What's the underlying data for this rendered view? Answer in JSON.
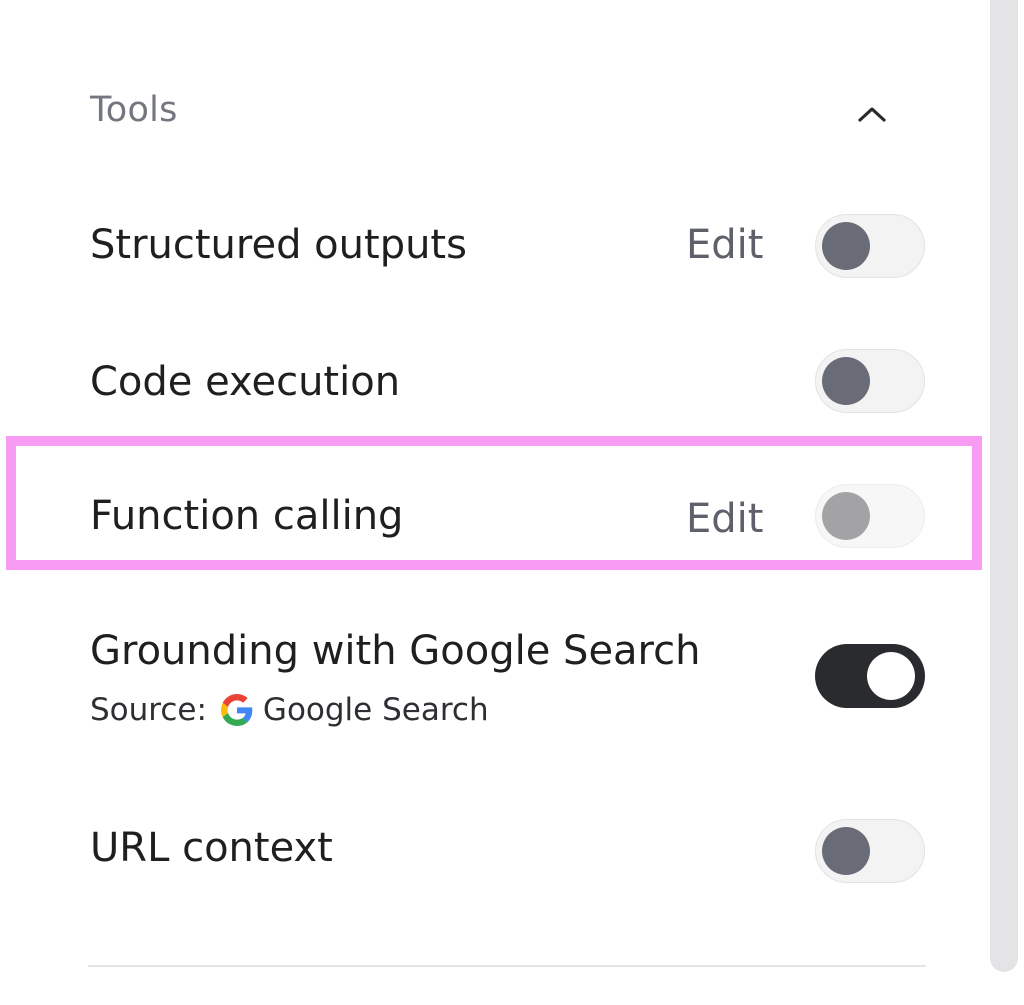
{
  "tools_section": {
    "title": "Tools",
    "collapse_icon": "chevron-up-icon",
    "rows": [
      {
        "label": "Structured outputs",
        "edit_label": "Edit",
        "toggle_state": "off"
      },
      {
        "label": "Code execution",
        "toggle_state": "off"
      },
      {
        "label": "Function calling",
        "edit_label": "Edit",
        "toggle_state": "off-disabled"
      },
      {
        "label": "Grounding with Google Search",
        "source_label": "Source:",
        "source_name": "Google Search",
        "source_icon": "google-g-icon",
        "toggle_state": "on"
      },
      {
        "label": "URL context",
        "toggle_state": "off"
      }
    ]
  },
  "colors": {
    "highlight": "#f79cf2",
    "toggle_on": "#2a2b2f",
    "toggle_knob_off": "#696b77"
  }
}
